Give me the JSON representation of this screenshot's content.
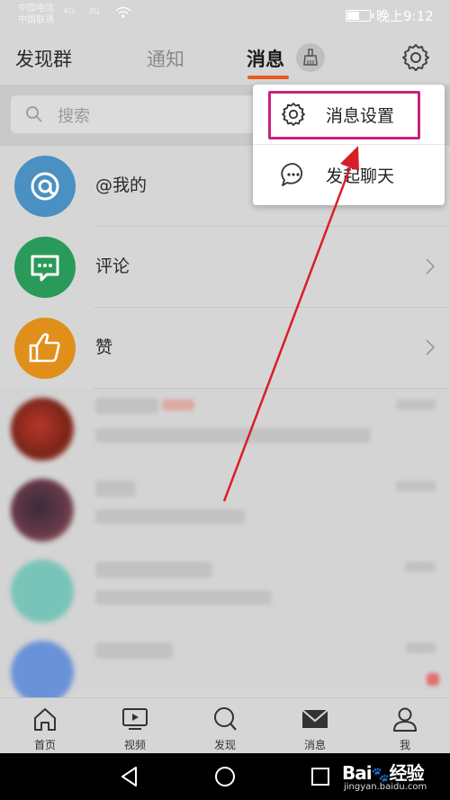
{
  "status_bar": {
    "carrier1": "中国电信",
    "carrier2": "中国联通",
    "signal1": "4G",
    "signal2": "3G",
    "battery_level": 0.55,
    "time": "晚上9:12"
  },
  "header": {
    "tabs": [
      {
        "label": "发现群"
      },
      {
        "label": "通知"
      },
      {
        "label": "消息"
      }
    ],
    "active_tab": "消息",
    "accent_color": "#e85a1c"
  },
  "search": {
    "placeholder": "搜索"
  },
  "list": {
    "items": [
      {
        "label": "@我的",
        "icon": "at-icon",
        "color": "#4a90c2"
      },
      {
        "label": "评论",
        "icon": "comment-icon",
        "color": "#2a9a5a"
      },
      {
        "label": "赞",
        "icon": "thumbs-up-icon",
        "color": "#e0901a"
      }
    ]
  },
  "dropdown": {
    "items": [
      {
        "label": "消息设置",
        "icon": "gear-icon"
      },
      {
        "label": "发起聊天",
        "icon": "chat-bubble-icon"
      }
    ],
    "highlight_color": "#c8247e"
  },
  "bottom_nav": {
    "items": [
      {
        "label": "首页",
        "icon": "home-icon"
      },
      {
        "label": "视频",
        "icon": "video-icon"
      },
      {
        "label": "发现",
        "icon": "discover-icon"
      },
      {
        "label": "消息",
        "icon": "mail-icon"
      },
      {
        "label": "我",
        "icon": "profile-icon"
      }
    ]
  },
  "watermark": {
    "brand": "Bai",
    "brand2": "经验",
    "url": "jingyan.baidu.com"
  }
}
